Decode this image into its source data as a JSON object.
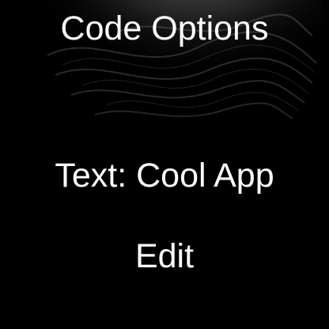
{
  "screen": {
    "title": "Code Options",
    "text_setting": "Text: Cool App",
    "edit_label": "Edit"
  },
  "colors": {
    "background": "#000000",
    "text": "#ffffff"
  }
}
